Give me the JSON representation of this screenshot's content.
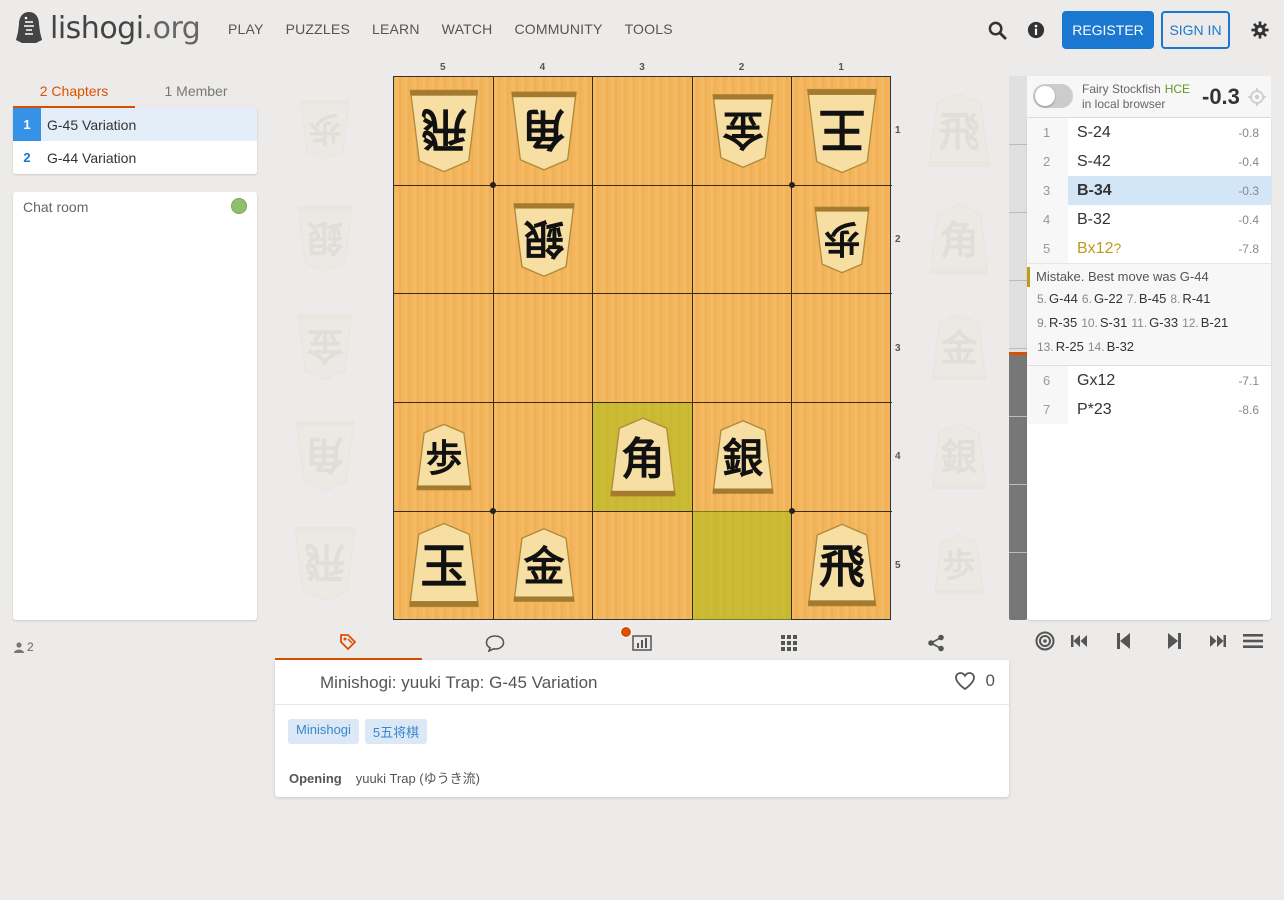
{
  "header": {
    "logo_text": "lishogi",
    "logo_ext": ".org",
    "nav": [
      "PLAY",
      "PUZZLES",
      "LEARN",
      "WATCH",
      "COMMUNITY",
      "TOOLS"
    ],
    "register_label": "REGISTER",
    "signin_label": "SIGN IN"
  },
  "left": {
    "tabs": [
      "2 Chapters",
      "1 Member"
    ],
    "chapters": [
      {
        "num": "1",
        "label": "G-45 Variation"
      },
      {
        "num": "2",
        "label": "G-44 Variation"
      }
    ],
    "chat_title": "Chat room",
    "watchers": "2"
  },
  "board": {
    "files": [
      "5",
      "4",
      "3",
      "2",
      "1"
    ],
    "ranks": [
      "1",
      "2",
      "3",
      "4",
      "5"
    ],
    "pieces": [
      {
        "file": 0,
        "rank": 0,
        "kanji": "飛",
        "gote": true
      },
      {
        "file": 1,
        "rank": 0,
        "kanji": "角",
        "gote": true
      },
      {
        "file": 3,
        "rank": 0,
        "kanji": "金",
        "gote": true
      },
      {
        "file": 4,
        "rank": 0,
        "kanji": "王",
        "gote": true
      },
      {
        "file": 1,
        "rank": 1,
        "kanji": "銀",
        "gote": true
      },
      {
        "file": 4,
        "rank": 1,
        "kanji": "歩",
        "gote": true
      },
      {
        "file": 0,
        "rank": 3,
        "kanji": "歩",
        "gote": false
      },
      {
        "file": 2,
        "rank": 3,
        "kanji": "角",
        "gote": false
      },
      {
        "file": 3,
        "rank": 3,
        "kanji": "銀",
        "gote": false
      },
      {
        "file": 0,
        "rank": 4,
        "kanji": "玉",
        "gote": false
      },
      {
        "file": 1,
        "rank": 4,
        "kanji": "金",
        "gote": false
      },
      {
        "file": 4,
        "rank": 4,
        "kanji": "飛",
        "gote": false
      }
    ],
    "highlights": [
      {
        "file": 2,
        "rank": 3
      },
      {
        "file": 3,
        "rank": 4
      }
    ],
    "gote_hand": [
      "歩",
      "銀",
      "金",
      "角",
      "飛"
    ],
    "sente_hand": [
      "飛",
      "角",
      "金",
      "銀",
      "歩"
    ]
  },
  "ceval": {
    "engine": "Fairy Stockfish",
    "engine_tag": "HCE",
    "engine_sub": "in local browser",
    "score": "-0.3",
    "gauge_black_fraction": 0.49
  },
  "moves": {
    "main": [
      {
        "n": "1",
        "san": "S-24",
        "eval": "-0.8"
      },
      {
        "n": "2",
        "san": "S-42",
        "eval": "-0.4"
      },
      {
        "n": "3",
        "san": "B-34",
        "eval": "-0.3",
        "active": true
      },
      {
        "n": "4",
        "san": "B-32",
        "eval": "-0.4"
      },
      {
        "n": "5",
        "san": "Bx12",
        "glyph": "?",
        "eval": "-7.8",
        "mistake": true
      }
    ],
    "comment": "Mistake. Best move was G-44",
    "variation": [
      [
        {
          "n": "5.",
          "m": "G-44"
        },
        {
          "n": "6.",
          "m": "G-22"
        },
        {
          "n": "7.",
          "m": "B-45"
        },
        {
          "n": "8.",
          "m": "R-41"
        }
      ],
      [
        {
          "n": "9.",
          "m": "R-35"
        },
        {
          "n": "10.",
          "m": "S-31"
        },
        {
          "n": "11.",
          "m": "G-33"
        },
        {
          "n": "12.",
          "m": "B-21"
        }
      ],
      [
        {
          "n": "13.",
          "m": "R-25"
        },
        {
          "n": "14.",
          "m": "B-32"
        }
      ]
    ],
    "after": [
      {
        "n": "6",
        "san": "Gx12",
        "eval": "-7.1"
      },
      {
        "n": "7",
        "san": "P*23",
        "eval": "-8.6"
      }
    ]
  },
  "study": {
    "title": "Minishogi: yuuki Trap: G-45 Variation",
    "likes": "0",
    "tags": [
      "Minishogi",
      "5五将棋"
    ],
    "opening_label": "Opening",
    "opening_value": "yuuki Trap (ゆうき流)",
    "notification_dot": true
  }
}
